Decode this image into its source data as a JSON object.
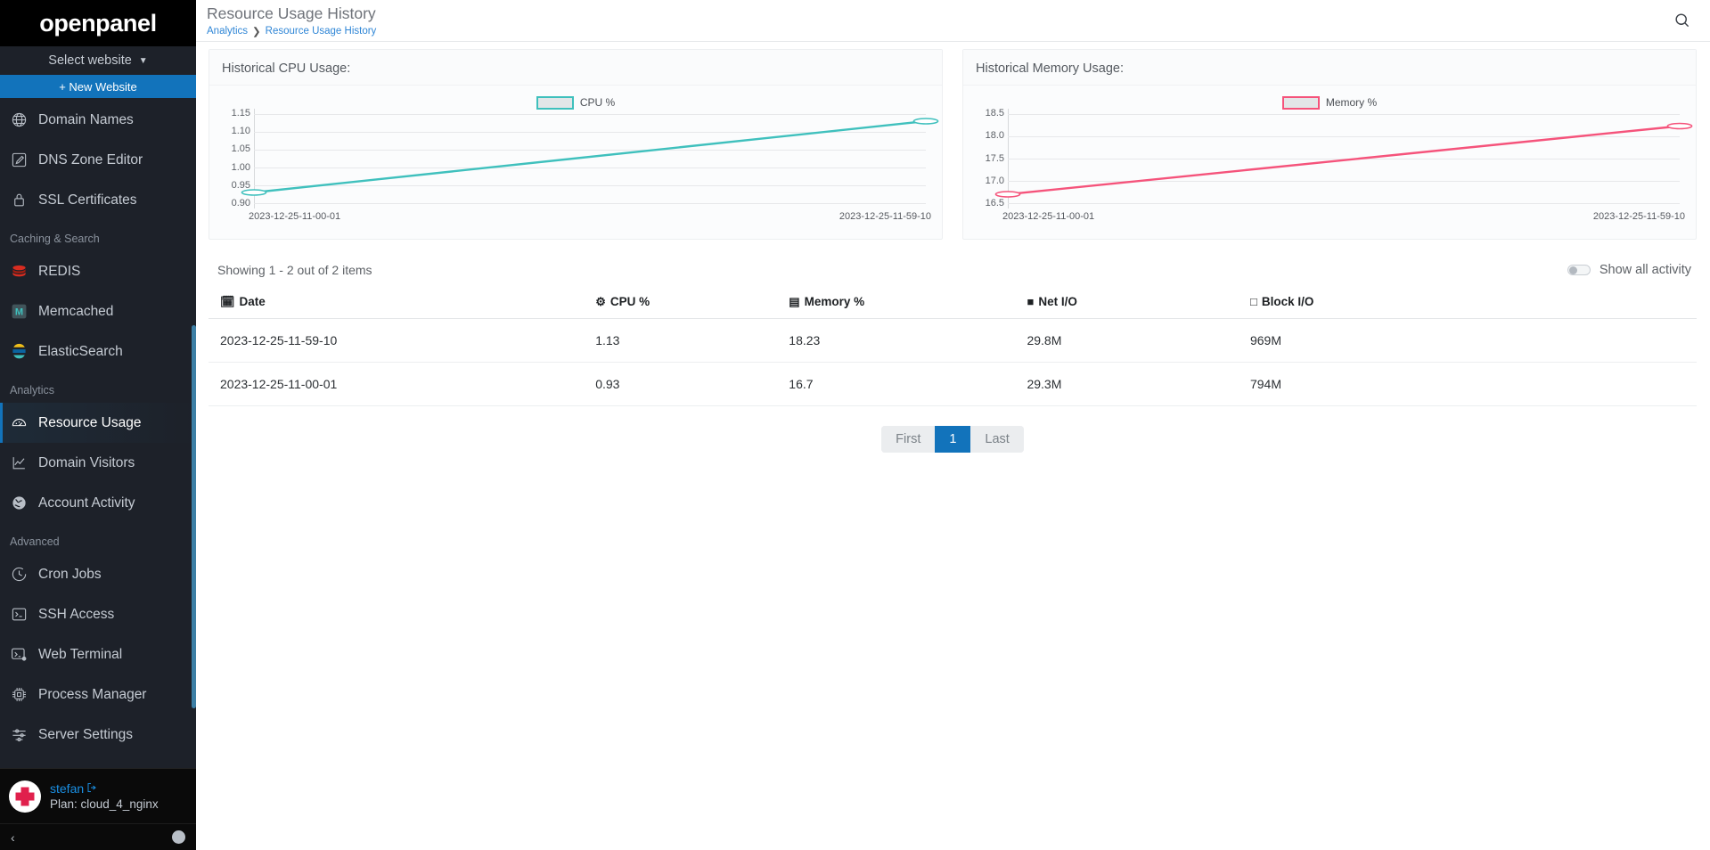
{
  "brand": {
    "name": "openpanel"
  },
  "sidebar": {
    "select_website": "Select website",
    "new_website": "+ New Website",
    "items": [
      {
        "label": "Domain Names",
        "icon": "globe-icon"
      },
      {
        "label": "DNS Zone Editor",
        "icon": "edit-square-icon"
      },
      {
        "label": "SSL Certificates",
        "icon": "lock-icon"
      }
    ],
    "section_caching": "Caching & Search",
    "caching_items": [
      {
        "label": "REDIS",
        "icon": "redis-icon"
      },
      {
        "label": "Memcached",
        "icon": "memcached-icon"
      },
      {
        "label": "ElasticSearch",
        "icon": "elasticsearch-icon"
      }
    ],
    "section_analytics": "Analytics",
    "analytics_items": [
      {
        "label": "Resource Usage",
        "icon": "gauge-icon",
        "active": true
      },
      {
        "label": "Domain Visitors",
        "icon": "line-chart-icon",
        "active": false
      },
      {
        "label": "Account Activity",
        "icon": "globe-activity-icon",
        "active": false
      }
    ],
    "section_advanced": "Advanced",
    "advanced_items": [
      {
        "label": "Cron Jobs",
        "icon": "clock-icon"
      },
      {
        "label": "SSH Access",
        "icon": "terminal-icon"
      },
      {
        "label": "Web Terminal",
        "icon": "web-terminal-icon"
      },
      {
        "label": "Process Manager",
        "icon": "cpu-chip-icon"
      },
      {
        "label": "Server Settings",
        "icon": "server-sliders-icon"
      }
    ],
    "user": {
      "name": "stefan",
      "plan": "Plan: cloud_4_nginx"
    },
    "footer": {
      "collapse": "‹",
      "info": "i"
    }
  },
  "header": {
    "title": "Resource Usage History",
    "breadcrumb": [
      "Analytics",
      "Resource Usage History"
    ],
    "breadcrumb_separator": "❯",
    "search_icon": "search-icon"
  },
  "charts": {
    "cpu": {
      "title": "Historical CPU Usage:"
    },
    "memory": {
      "title": "Historical Memory Usage:"
    }
  },
  "chart_data": [
    {
      "type": "line",
      "title": "Historical CPU Usage:",
      "xlabel": "",
      "ylabel": "",
      "x": [
        "2023-12-25-11-00-01",
        "2023-12-25-11-59-10"
      ],
      "series": [
        {
          "name": "CPU %",
          "values": [
            0.93,
            1.13
          ],
          "color": "#3fc0bd"
        }
      ],
      "yticks": [
        1.15,
        1.1,
        1.05,
        1.0,
        0.95,
        0.9
      ],
      "ytick_labels": [
        "1.15",
        "1.10",
        "1.05",
        "1.00",
        "0.95",
        "0.90"
      ],
      "ylim": [
        0.9,
        1.15
      ],
      "grid": true,
      "legend": "top-center",
      "legend_entries": [
        "CPU %"
      ]
    },
    {
      "type": "line",
      "title": "Historical Memory Usage:",
      "xlabel": "",
      "ylabel": "",
      "x": [
        "2023-12-25-11-00-01",
        "2023-12-25-11-59-10"
      ],
      "series": [
        {
          "name": "Memory %",
          "values": [
            16.7,
            18.23
          ],
          "color": "#f5537b"
        }
      ],
      "yticks": [
        18.5,
        18.0,
        17.5,
        17.0,
        16.5
      ],
      "ytick_labels": [
        "18.5",
        "18.0",
        "17.5",
        "17.0",
        "16.5"
      ],
      "ylim": [
        16.5,
        18.5
      ],
      "grid": true,
      "legend": "top-center",
      "legend_entries": [
        "Memory %"
      ]
    }
  ],
  "table_area": {
    "showing": "Showing 1 - 2 out of 2 items",
    "toggle_label": "Show all activity",
    "toggle_on": false,
    "columns": [
      {
        "label": "Date",
        "icon": "calendar-icon",
        "glyph": "🗓"
      },
      {
        "label": "CPU %",
        "icon": "cpu-chip-icon",
        "glyph": "⚙"
      },
      {
        "label": "Memory %",
        "icon": "memory-icon",
        "glyph": "▤"
      },
      {
        "label": "Net I/O",
        "icon": "network-icon",
        "glyph": "■"
      },
      {
        "label": "Block I/O",
        "icon": "floppy-disk-icon",
        "glyph": "□"
      }
    ],
    "rows": [
      {
        "date": "2023-12-25-11-59-10",
        "cpu": "1.13",
        "memory": "18.23",
        "net_io": "29.8M",
        "block_io": "969M"
      },
      {
        "date": "2023-12-25-11-00-01",
        "cpu": "0.93",
        "memory": "16.7",
        "net_io": "29.3M",
        "block_io": "794M"
      }
    ],
    "pagination": {
      "first": "First",
      "current": "1",
      "last": "Last"
    }
  },
  "colors": {
    "accent": "#1273bb",
    "cpu_line": "#3fc0bd",
    "memory_line": "#f5537b",
    "sidebar_bg": "#1d2129",
    "link": "#2f86d6"
  }
}
